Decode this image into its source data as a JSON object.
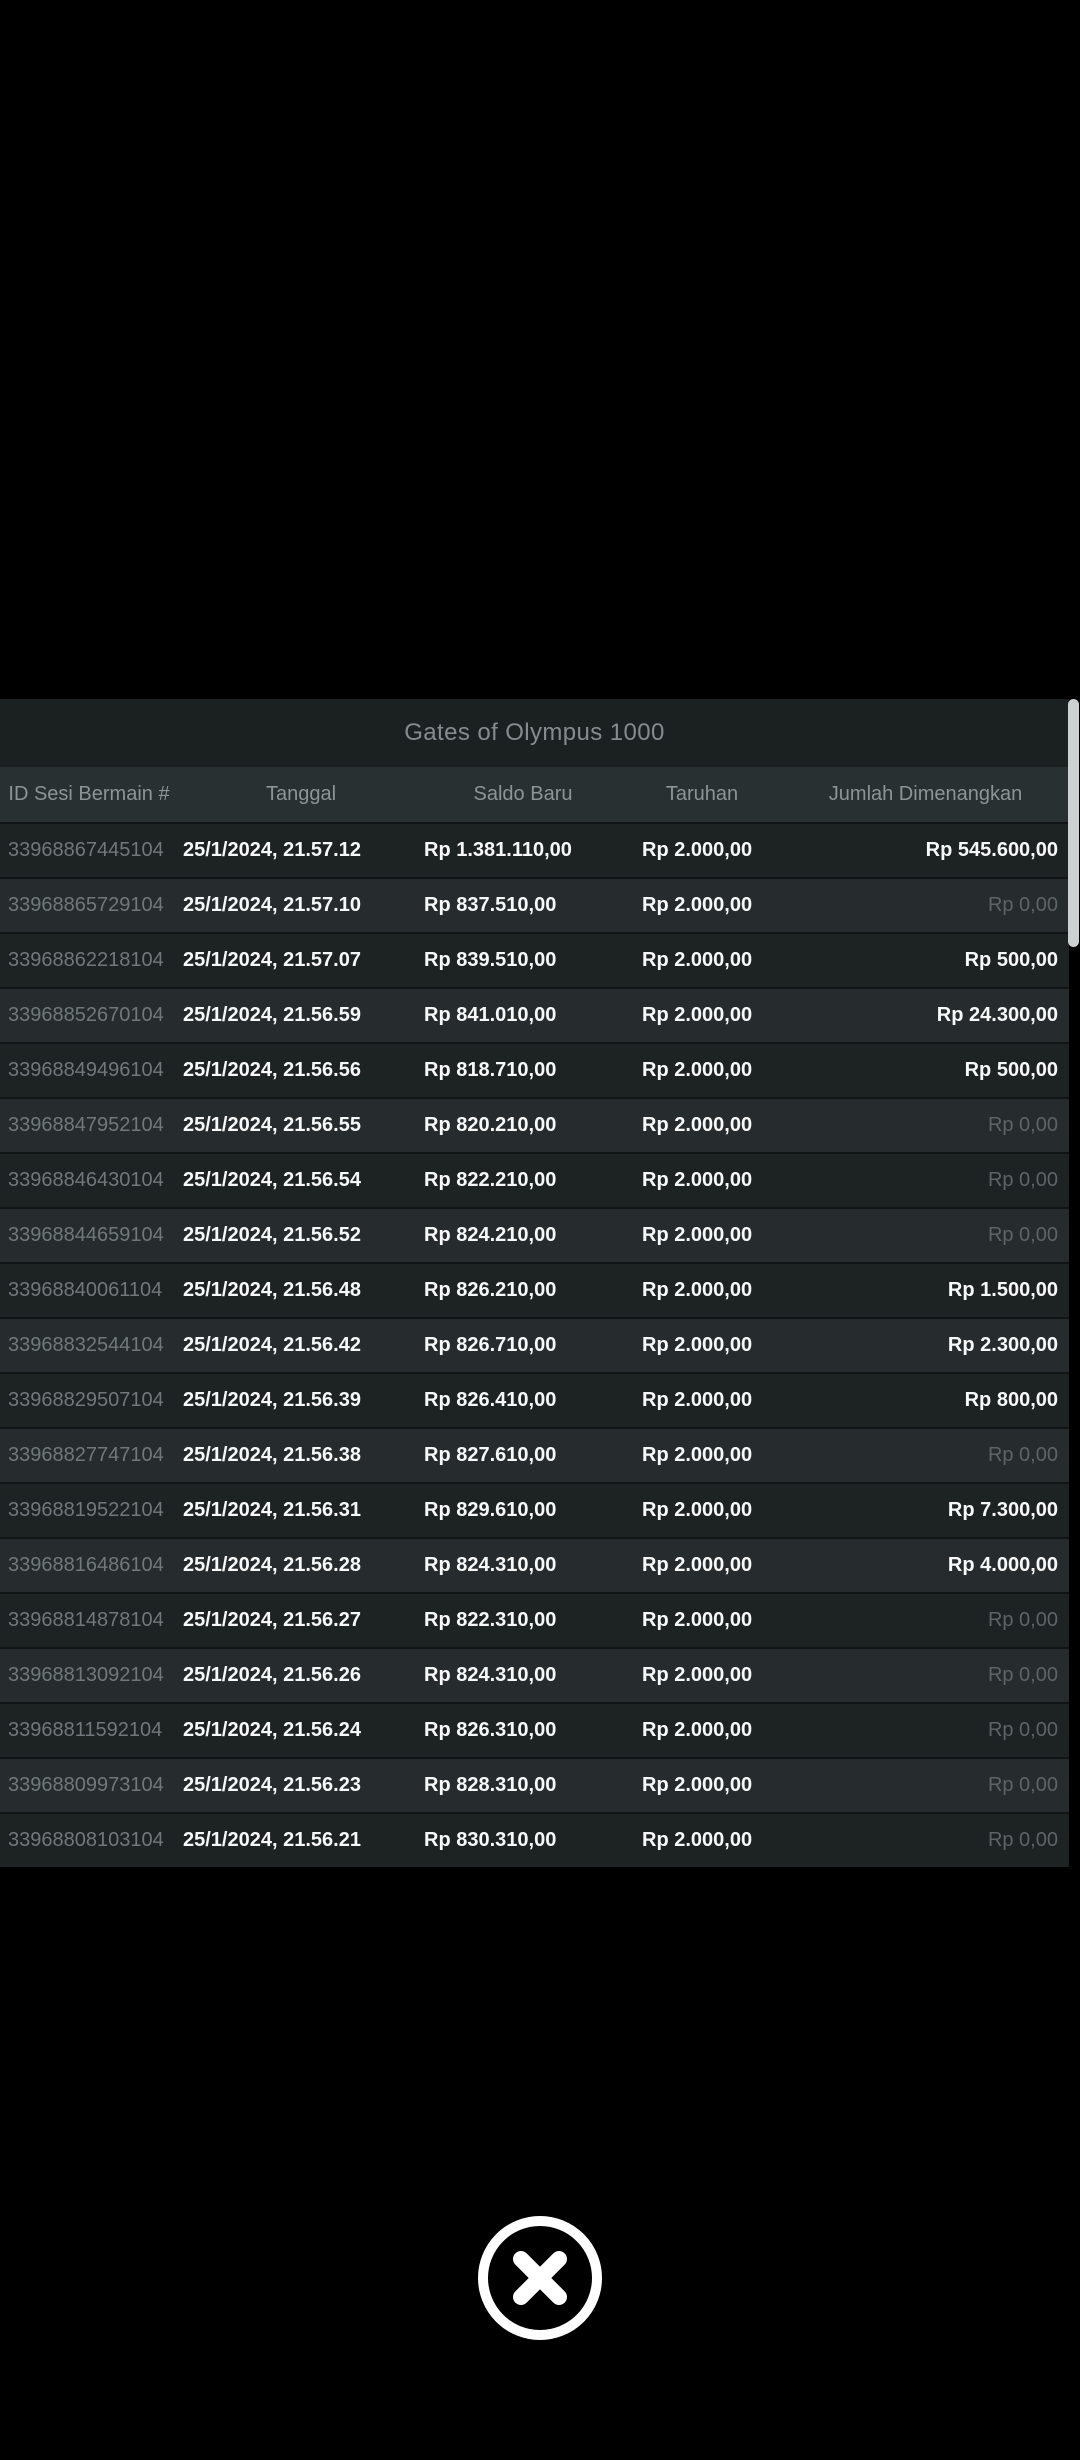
{
  "modal": {
    "title": "Gates of Olympus 1000"
  },
  "table": {
    "columns": [
      "ID Sesi Bermain #",
      "Tanggal",
      "Saldo Baru",
      "Taruhan",
      "Jumlah Dimenangkan"
    ],
    "rows": [
      {
        "id": "33968867445104",
        "date": "25/1/2024, 21.57.12",
        "balance": "Rp 1.381.110,00",
        "bet": "Rp 2.000,00",
        "win": "Rp 545.600,00",
        "win_dim": false
      },
      {
        "id": "33968865729104",
        "date": "25/1/2024, 21.57.10",
        "balance": "Rp 837.510,00",
        "bet": "Rp 2.000,00",
        "win": "Rp 0,00",
        "win_dim": true
      },
      {
        "id": "33968862218104",
        "date": "25/1/2024, 21.57.07",
        "balance": "Rp 839.510,00",
        "bet": "Rp 2.000,00",
        "win": "Rp 500,00",
        "win_dim": false
      },
      {
        "id": "33968852670104",
        "date": "25/1/2024, 21.56.59",
        "balance": "Rp 841.010,00",
        "bet": "Rp 2.000,00",
        "win": "Rp 24.300,00",
        "win_dim": false
      },
      {
        "id": "33968849496104",
        "date": "25/1/2024, 21.56.56",
        "balance": "Rp 818.710,00",
        "bet": "Rp 2.000,00",
        "win": "Rp 500,00",
        "win_dim": false
      },
      {
        "id": "33968847952104",
        "date": "25/1/2024, 21.56.55",
        "balance": "Rp 820.210,00",
        "bet": "Rp 2.000,00",
        "win": "Rp 0,00",
        "win_dim": true
      },
      {
        "id": "33968846430104",
        "date": "25/1/2024, 21.56.54",
        "balance": "Rp 822.210,00",
        "bet": "Rp 2.000,00",
        "win": "Rp 0,00",
        "win_dim": true
      },
      {
        "id": "33968844659104",
        "date": "25/1/2024, 21.56.52",
        "balance": "Rp 824.210,00",
        "bet": "Rp 2.000,00",
        "win": "Rp 0,00",
        "win_dim": true
      },
      {
        "id": "33968840061104",
        "date": "25/1/2024, 21.56.48",
        "balance": "Rp 826.210,00",
        "bet": "Rp 2.000,00",
        "win": "Rp 1.500,00",
        "win_dim": false
      },
      {
        "id": "33968832544104",
        "date": "25/1/2024, 21.56.42",
        "balance": "Rp 826.710,00",
        "bet": "Rp 2.000,00",
        "win": "Rp 2.300,00",
        "win_dim": false
      },
      {
        "id": "33968829507104",
        "date": "25/1/2024, 21.56.39",
        "balance": "Rp 826.410,00",
        "bet": "Rp 2.000,00",
        "win": "Rp 800,00",
        "win_dim": false
      },
      {
        "id": "33968827747104",
        "date": "25/1/2024, 21.56.38",
        "balance": "Rp 827.610,00",
        "bet": "Rp 2.000,00",
        "win": "Rp 0,00",
        "win_dim": true
      },
      {
        "id": "33968819522104",
        "date": "25/1/2024, 21.56.31",
        "balance": "Rp 829.610,00",
        "bet": "Rp 2.000,00",
        "win": "Rp 7.300,00",
        "win_dim": false
      },
      {
        "id": "33968816486104",
        "date": "25/1/2024, 21.56.28",
        "balance": "Rp 824.310,00",
        "bet": "Rp 2.000,00",
        "win": "Rp 4.000,00",
        "win_dim": false
      },
      {
        "id": "33968814878104",
        "date": "25/1/2024, 21.56.27",
        "balance": "Rp 822.310,00",
        "bet": "Rp 2.000,00",
        "win": "Rp 0,00",
        "win_dim": true
      },
      {
        "id": "33968813092104",
        "date": "25/1/2024, 21.56.26",
        "balance": "Rp 824.310,00",
        "bet": "Rp 2.000,00",
        "win": "Rp 0,00",
        "win_dim": true
      },
      {
        "id": "33968811592104",
        "date": "25/1/2024, 21.56.24",
        "balance": "Rp 826.310,00",
        "bet": "Rp 2.000,00",
        "win": "Rp 0,00",
        "win_dim": true
      },
      {
        "id": "33968809973104",
        "date": "25/1/2024, 21.56.23",
        "balance": "Rp 828.310,00",
        "bet": "Rp 2.000,00",
        "win": "Rp 0,00",
        "win_dim": true
      },
      {
        "id": "33968808103104",
        "date": "25/1/2024, 21.56.21",
        "balance": "Rp 830.310,00",
        "bet": "Rp 2.000,00",
        "win": "Rp 0,00",
        "win_dim": true
      }
    ]
  },
  "colors": {
    "background": "#000000",
    "titlebar_bg": "#1b2021",
    "header_bg": "#293031",
    "row_odd_bg": "#1d2223",
    "row_even_bg": "#262c2d",
    "text_bright": "#f7f8f8",
    "text_dim": "#5d6467",
    "text_id": "#71787b",
    "scrollbar": "#ccd0d1",
    "close_icon": "#ffffff"
  }
}
